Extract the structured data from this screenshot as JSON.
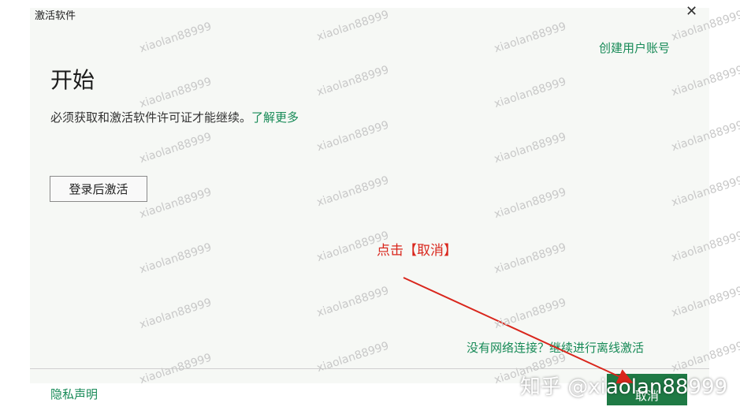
{
  "window": {
    "title": "激活软件",
    "close_glyph": "✕",
    "close_icon": "close-icon"
  },
  "header": {
    "create_account_link": "创建用户账号"
  },
  "main": {
    "heading": "开始",
    "description": "必须获取和激活软件许可证才能继续。",
    "learn_more": "了解更多",
    "signin_button": "登录后激活",
    "offline_link": "没有网络连接？继续进行离线激活"
  },
  "footer": {
    "privacy_link": "隐私声明",
    "cancel_button": "取消"
  },
  "annotation": {
    "text": "点击【取消】",
    "color": "#d9261c"
  },
  "watermark": {
    "repeated_text": "xiaolan88999",
    "brand_text": "知乎 @xiaolan88999"
  },
  "colors": {
    "accent": "#178a57",
    "primary_button": "#1f7a45",
    "background": "#f6f8f5"
  }
}
